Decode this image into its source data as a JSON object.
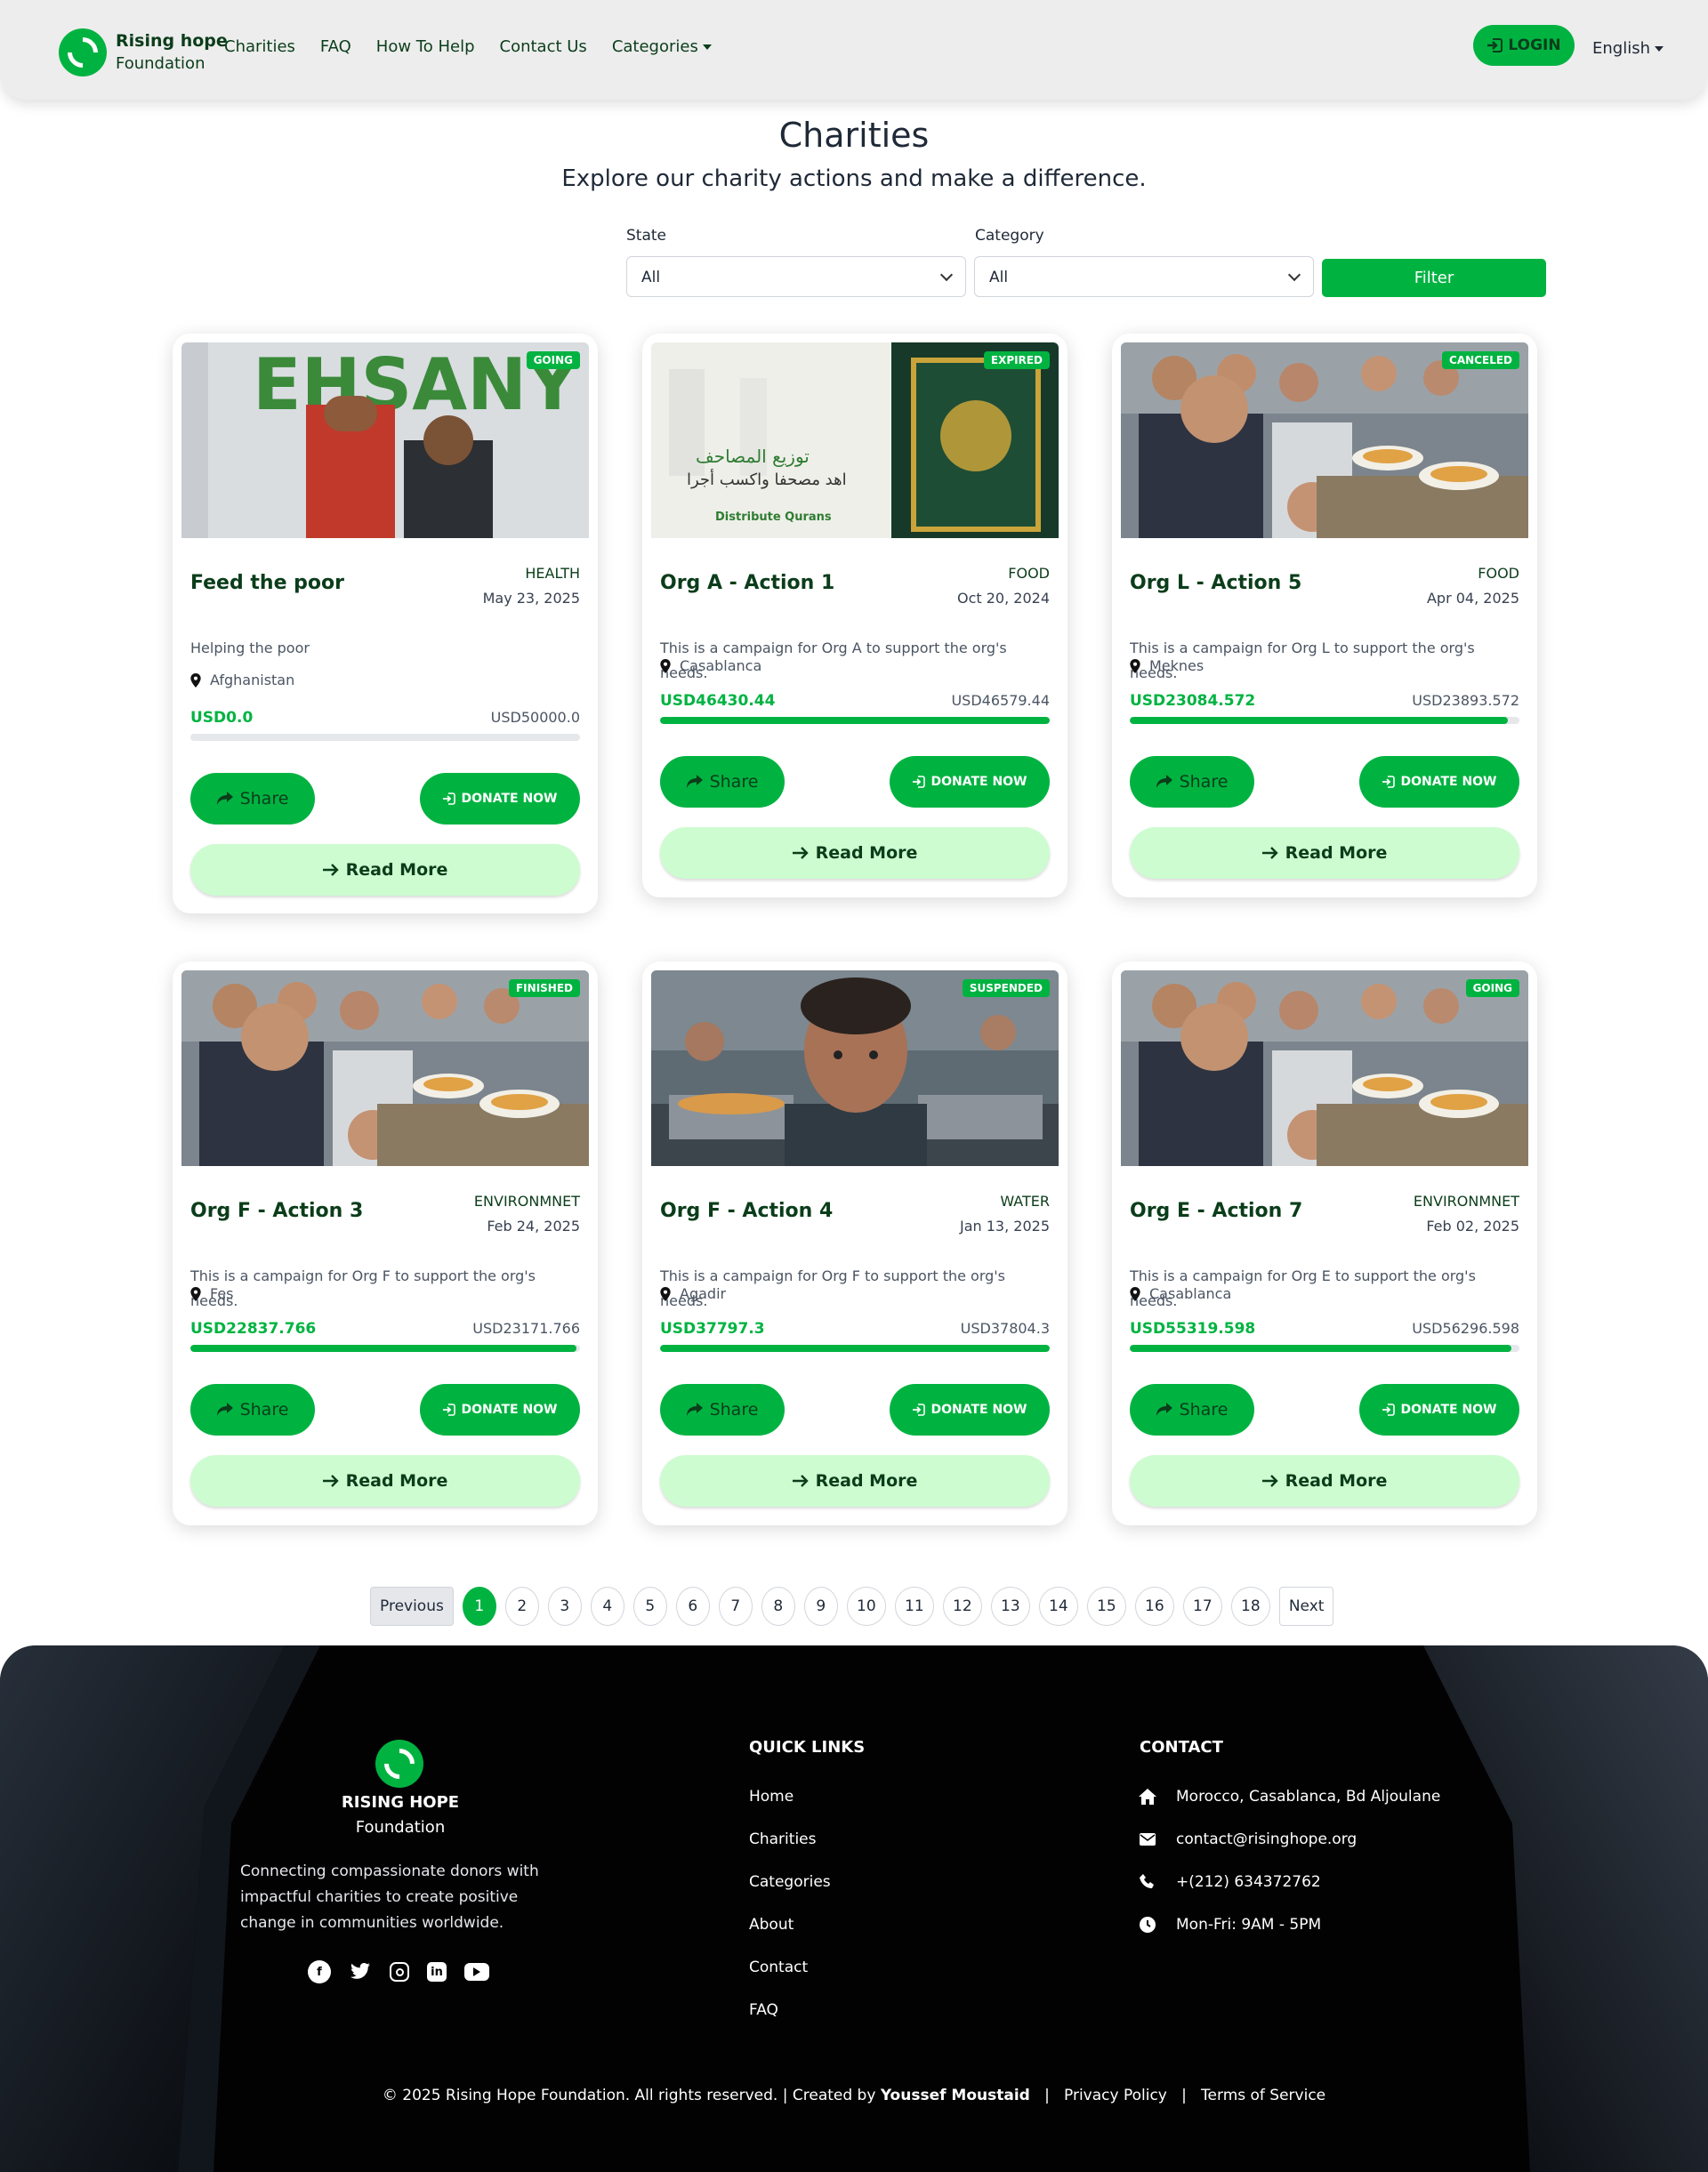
{
  "colors": {
    "accent": "#00b341",
    "dark_green": "#0b3d1a",
    "light_green": "#cdfcd0",
    "footer_bg": "#020203"
  },
  "navbar": {
    "brand_name": "Rising hope",
    "brand_sub": "Foundation",
    "links": [
      "Charities",
      "FAQ",
      "How To Help",
      "Contact Us",
      "Categories"
    ],
    "login_label": "LOGIN",
    "language": "English"
  },
  "header": {
    "title": "Charities",
    "subtitle": "Explore our charity actions and make a difference."
  },
  "filters": {
    "state_label": "State",
    "state_value": "All",
    "category_label": "Category",
    "category_value": "All",
    "filter_button": "Filter"
  },
  "buttons": {
    "share": "Share",
    "donate": "DONATE NOW",
    "read_more": "Read More"
  },
  "cards": [
    {
      "status": "GOING",
      "title": "Feed the poor",
      "category": "HEALTH",
      "date": "May 23, 2025",
      "description": "Helping the poor",
      "location": "Afghanistan",
      "raised": "USD0.0",
      "goal": "USD50000.0",
      "progress": 0.0,
      "image": "ehsany-volunteers-photo"
    },
    {
      "status": "EXPIRED",
      "title": "Org A - Action 1",
      "category": "FOOD",
      "date": "Oct 20, 2024",
      "description": "This is a campaign for Org A to support the org's needs.",
      "location": "Casablanca",
      "raised": "USD46430.44",
      "goal": "USD46579.44",
      "progress": 0.997,
      "image": "quran-distribution-photo"
    },
    {
      "status": "CANCELED",
      "title": "Org L - Action 5",
      "category": "FOOD",
      "date": "Apr 04, 2025",
      "description": "This is a campaign for Org L to support the org's needs.",
      "location": "Meknes",
      "raised": "USD23084.572",
      "goal": "USD23893.572",
      "progress": 0.966,
      "image": "children-food-line-photo"
    },
    {
      "status": "FINISHED",
      "title": "Org F - Action 3",
      "category": "ENVIRONMNET",
      "date": "Feb 24, 2025",
      "description": "This is a campaign for Org F to support the org's needs.",
      "location": "Fes",
      "raised": "USD22837.766",
      "goal": "USD23171.766",
      "progress": 0.986,
      "image": "children-food-line-photo"
    },
    {
      "status": "SUSPENDED",
      "title": "Org F - Action 4",
      "category": "WATER",
      "date": "Jan 13, 2025",
      "description": "This is a campaign for Org F to support the org's needs.",
      "location": "Agadir",
      "raised": "USD37797.3",
      "goal": "USD37804.3",
      "progress": 0.9998,
      "image": "child-portrait-photo"
    },
    {
      "status": "GOING",
      "title": "Org E - Action 7",
      "category": "ENVIRONMNET",
      "date": "Feb 02, 2025",
      "description": "This is a campaign for Org E to support the org's needs.",
      "location": "Casablanca",
      "raised": "USD55319.598",
      "goal": "USD56296.598",
      "progress": 0.983,
      "image": "children-food-line-photo"
    }
  ],
  "pagination": {
    "previous": "Previous",
    "pages": [
      "1",
      "2",
      "3",
      "4",
      "5",
      "6",
      "7",
      "8",
      "9",
      "10",
      "11",
      "12",
      "13",
      "14",
      "15",
      "16",
      "17",
      "18"
    ],
    "active": "1",
    "next": "Next"
  },
  "footer": {
    "brand_name": "RISING HOPE",
    "brand_sub": "Foundation",
    "description": "Connecting compassionate donors with impactful charities to create positive change in communities worldwide.",
    "social_icons": [
      "facebook-icon",
      "twitter-icon",
      "instagram-icon",
      "linkedin-icon",
      "youtube-icon"
    ],
    "quick_links_title": "QUICK LINKS",
    "quick_links": [
      "Home",
      "Charities",
      "Categories",
      "About",
      "Contact",
      "FAQ"
    ],
    "contact_title": "CONTACT",
    "address": "Morocco, Casablanca, Bd Aljoulane",
    "email": "contact@risinghope.org",
    "phone": "+(212) 634372762",
    "hours": "Mon-Fri: 9AM - 5PM",
    "copyright_prefix": "© 2025 Rising Hope Foundation. All rights reserved. | Created by",
    "creator": "Youssef Moustaid",
    "separator": "|",
    "privacy": "Privacy Policy",
    "terms": "Terms of Service"
  }
}
